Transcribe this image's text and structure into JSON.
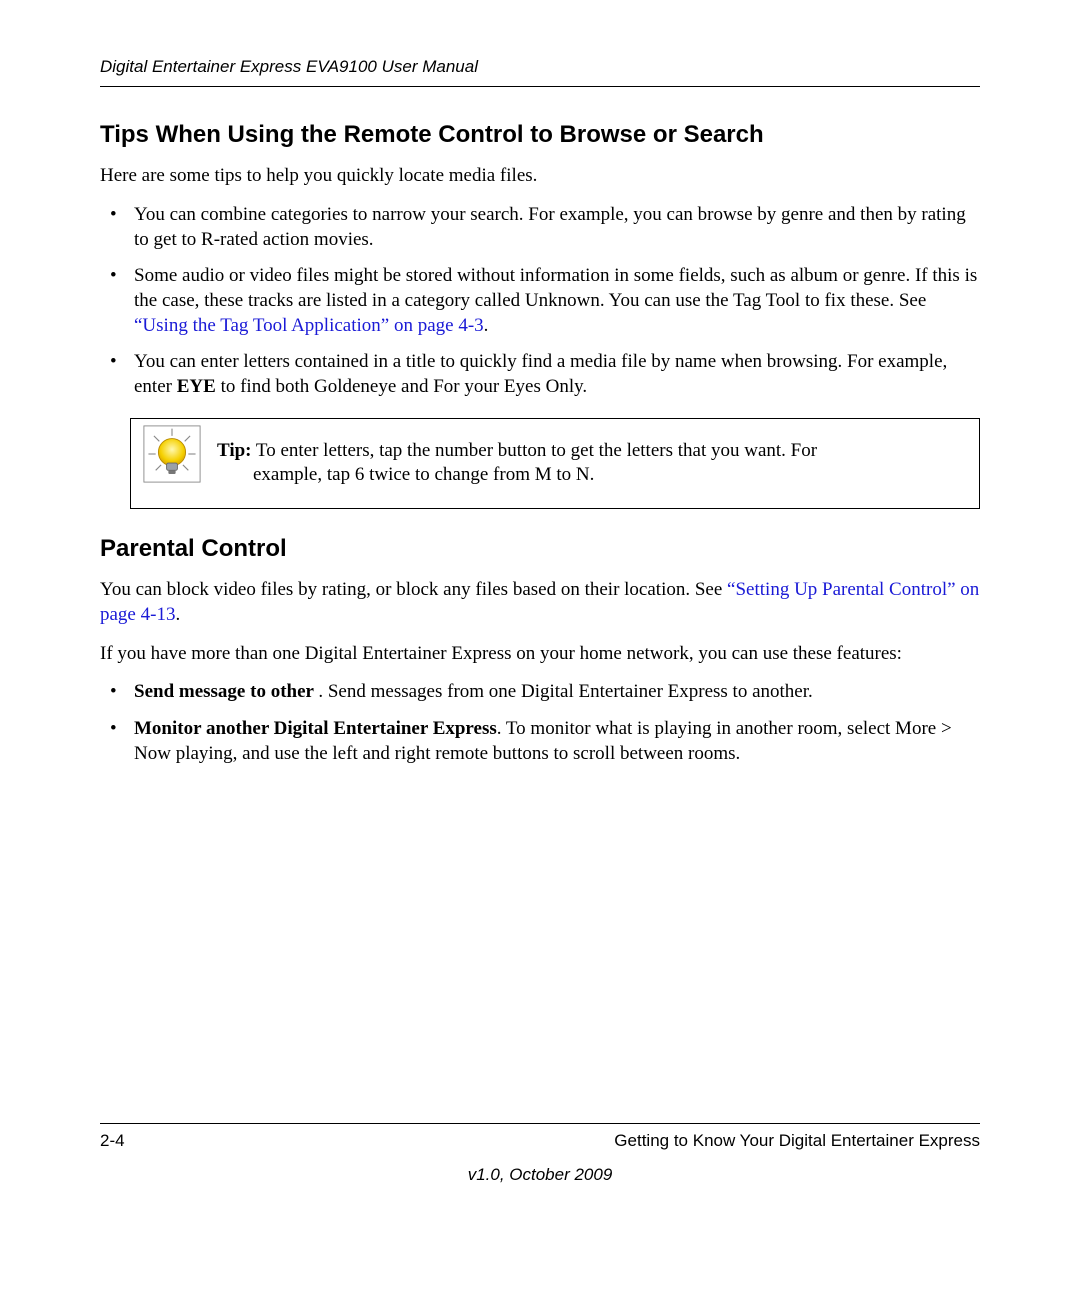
{
  "header": {
    "running": "Digital Entertainer Express EVA9100 User Manual"
  },
  "section1": {
    "title": "Tips When Using the Remote Control to Browse or Search",
    "intro": "Here are some tips to help you quickly locate media files.",
    "bullets": {
      "b1": "You can combine categories to narrow your search. For example, you can browse by genre and then by rating to get to R-rated action movies.",
      "b2_pre": "Some audio or video files might be stored without information in some fields, such as album or genre. If this is the case, these tracks are listed in a category called Unknown. You can use the Tag Tool to fix these. See ",
      "b2_link": "“Using the Tag Tool Application” on page 4-3",
      "b2_post": ".",
      "b3_pre": "You can enter letters contained in a title to quickly find a media file by name when browsing. For example, enter ",
      "b3_bold": "EYE",
      "b3_post": " to find both Goldeneye and For your Eyes Only."
    },
    "tip": {
      "label": "Tip:",
      "line1": " To enter letters, tap the number button to get the letters that you want. For",
      "line2": "example, tap 6 twice to change from M to N."
    }
  },
  "section2": {
    "title": "Parental Control",
    "p1_pre": "You can block video files by rating, or block any files based on their location. See ",
    "p1_link": "“Setting Up Parental Control” on page 4-13",
    "p1_post": ".",
    "p2": "If you have more than one Digital Entertainer Express on your home network, you can use these features:",
    "bullets": {
      "b1_bold": "Send message to other ",
      "b1_rest": ". Send messages from one Digital Entertainer Express to another.",
      "b2_bold": "Monitor another Digital Entertainer Express",
      "b2_rest": ". To monitor what is playing in another room, select More > Now playing, and use the left and right remote buttons to scroll between rooms."
    }
  },
  "footer": {
    "pagenum": "2-4",
    "chapter": "Getting to Know Your Digital Entertainer Express",
    "version": "v1.0, October 2009"
  }
}
